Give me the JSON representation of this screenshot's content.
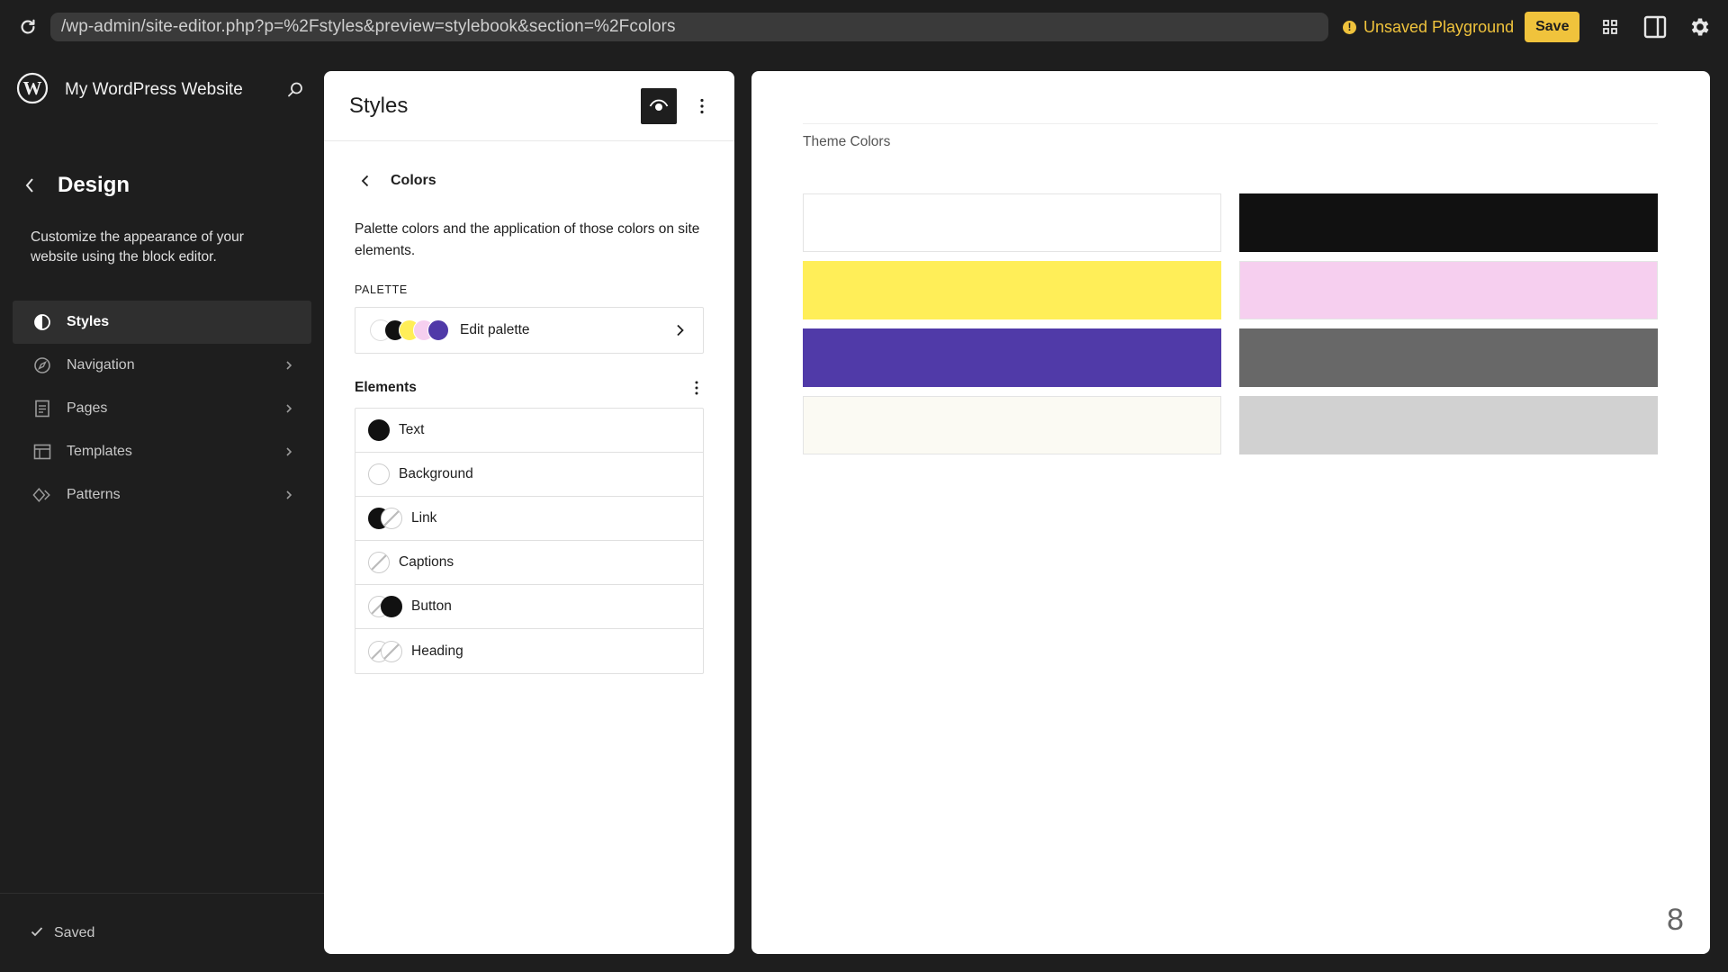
{
  "browser": {
    "url": "/wp-admin/site-editor.php?p=%2Fstyles&preview=stylebook&section=%2Fcolors",
    "status": "Unsaved Playground",
    "status_icon": "!",
    "save_label": "Save",
    "accent": "#f0c33c"
  },
  "sidebar": {
    "site_title": "My WordPress Website",
    "section_title": "Design",
    "description": "Customize the appearance of your website using the block editor.",
    "items": [
      {
        "label": "Styles",
        "icon": "contrast-icon"
      },
      {
        "label": "Navigation",
        "icon": "compass-icon"
      },
      {
        "label": "Pages",
        "icon": "page-icon"
      },
      {
        "label": "Templates",
        "icon": "layout-icon"
      },
      {
        "label": "Patterns",
        "icon": "diamond-icon"
      }
    ],
    "footer_status": "Saved"
  },
  "styles_panel": {
    "title": "Styles",
    "sub_title": "Colors",
    "description": "Palette colors and the application of those colors on site elements.",
    "palette_label": "PALETTE",
    "edit_palette": "Edit palette",
    "palette_swatches": [
      "#ffffff",
      "#111111",
      "#ffee58",
      "#f6cfef",
      "#503aa8"
    ],
    "elements_title": "Elements",
    "elements": [
      {
        "label": "Text"
      },
      {
        "label": "Background"
      },
      {
        "label": "Link"
      },
      {
        "label": "Captions"
      },
      {
        "label": "Button"
      },
      {
        "label": "Heading"
      }
    ]
  },
  "preview": {
    "section_label": "Theme Colors",
    "swatches": [
      "#ffffff",
      "#111111",
      "#ffee58",
      "#f6cfef",
      "#503aa8",
      "#686868",
      "#fbfaf3",
      "#d1d1d1"
    ],
    "page_number": "8"
  }
}
